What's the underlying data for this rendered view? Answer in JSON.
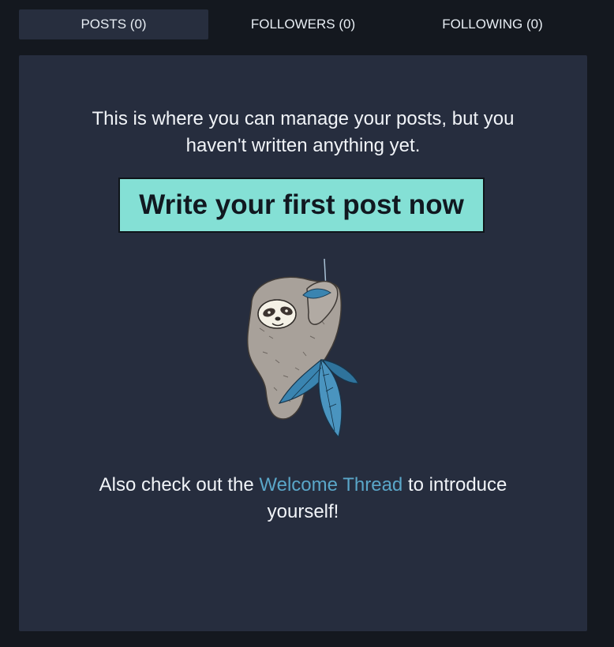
{
  "tabs": [
    {
      "label": "POSTS (0)",
      "active": true
    },
    {
      "label": "FOLLOWERS (0)",
      "active": false
    },
    {
      "label": "FOLLOWING (0)",
      "active": false
    }
  ],
  "empty_state": {
    "message": "This is where you can manage your posts, but you haven't written anything yet.",
    "cta_label": "Write your first post now",
    "illustration": "sloth-illustration",
    "outro_before": "Also check out the ",
    "outro_link": "Welcome Thread",
    "outro_after": " to introduce yourself!"
  },
  "colors": {
    "page_bg": "#14181f",
    "panel_bg": "#262d3e",
    "active_tab_bg": "#272e3e",
    "cta_bg": "#84e0d5",
    "link": "#5aa6c8"
  }
}
